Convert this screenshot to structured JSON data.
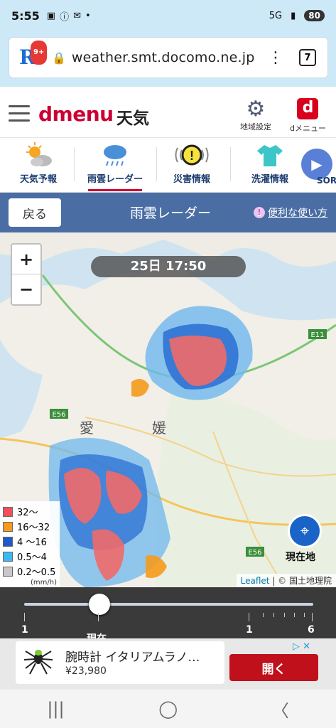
{
  "status": {
    "time": "5:55",
    "network": "5G",
    "battery": "80"
  },
  "browser": {
    "url": "weather.smt.docomo.ne.jp",
    "tab_count": "7",
    "app_badge": "9+"
  },
  "header": {
    "brand": "dmenu",
    "section": "天気",
    "region_label": "地域設定",
    "dmenu_label": "dメニュー",
    "dmenu_icon_letter": "d"
  },
  "nav": {
    "items": [
      {
        "label": "天気予報",
        "icon": "sun-cloud-icon"
      },
      {
        "label": "雨雲レーダー",
        "icon": "rain-cloud-icon",
        "active": true
      },
      {
        "label": "災害情報",
        "icon": "warning-icon"
      },
      {
        "label": "洗濯情報",
        "icon": "shirt-icon"
      }
    ],
    "partial_label": "SOR"
  },
  "titlebar": {
    "back": "戻る",
    "title": "雨雲レーダー",
    "help": "便利な使い方"
  },
  "map": {
    "timestamp": "25日 17:50",
    "zoom_in": "+",
    "zoom_out": "−",
    "legend": [
      {
        "label": "32〜",
        "color": "#f0505a"
      },
      {
        "label": "16〜32",
        "color": "#f59a1c"
      },
      {
        "label": "4 〜16",
        "color": "#1f58c9"
      },
      {
        "label": "0.5〜4",
        "color": "#39b9f2"
      },
      {
        "label": "0.2〜0.5",
        "color": "#c8c8c8"
      }
    ],
    "legend_unit": "(mm/h)",
    "labels": {
      "ehime1": "愛",
      "ehime2": "媛",
      "road": "E56",
      "e11": "E11"
    },
    "location_button_label": "現在地",
    "attribution_leaflet": "Leaflet",
    "attribution_rest": " | © 国土地理院"
  },
  "timeline": {
    "start": "1",
    "current": "現在",
    "mid": "1",
    "end": "6",
    "position_fraction": 0.26
  },
  "ad": {
    "title": "腕時計 イタリアムラノ…",
    "price": "¥23,980",
    "cta": "開く"
  }
}
